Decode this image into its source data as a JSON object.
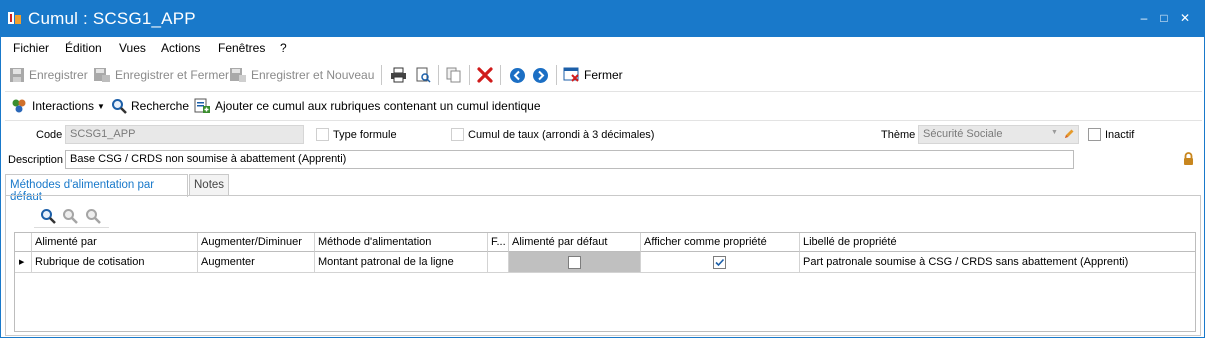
{
  "window": {
    "title": "Cumul : SCSG1_APP",
    "controls": {
      "minimize": "–",
      "maximize": "□",
      "close": "✕"
    }
  },
  "menu": [
    "Fichier",
    "Édition",
    "Vues",
    "Actions",
    "Fenêtres",
    "?"
  ],
  "toolbar": {
    "save": "Enregistrer",
    "save_close": "Enregistrer et Fermer",
    "save_new": "Enregistrer et Nouveau",
    "close": "Fermer"
  },
  "toolbar2": {
    "interactions": "Interactions",
    "search": "Recherche",
    "add_cumul": "Ajouter ce cumul aux rubriques contenant un cumul identique"
  },
  "form": {
    "code_label": "Code",
    "code_value": "SCSG1_APP",
    "type_formule_label": "Type formule",
    "type_formule_checked": false,
    "cumul_taux_label": "Cumul de taux (arrondi à 3 décimales)",
    "cumul_taux_checked": false,
    "theme_label": "Thème",
    "theme_value": "Sécurité Sociale",
    "inactif_label": "Inactif",
    "inactif_checked": false,
    "description_label": "Description",
    "description_value": "Base CSG / CRDS non soumise à abattement (Apprenti)"
  },
  "tabs": [
    {
      "label": "Méthodes d'alimentation par défaut",
      "active": true
    },
    {
      "label": "Notes",
      "active": false
    }
  ],
  "grid": {
    "columns": [
      "Alimenté par",
      "Augmenter/Diminuer",
      "Méthode d'alimentation",
      "F...",
      "Alimenté par défaut",
      "Afficher comme propriété",
      "Libellé de propriété"
    ],
    "rows": [
      {
        "alimente_par": "Rubrique de cotisation",
        "augmenter": "Augmenter",
        "methode": "Montant patronal de la ligne",
        "f": "",
        "alimente_defaut": false,
        "afficher_propriete": true,
        "libelle": "Part patronale soumise à CSG / CRDS sans abattement (Apprenti)"
      }
    ]
  },
  "colors": {
    "titlebar": "#1979ca",
    "accent": "#1979ca",
    "delete_red": "#d01b1b",
    "lock_orange": "#c8861e"
  }
}
